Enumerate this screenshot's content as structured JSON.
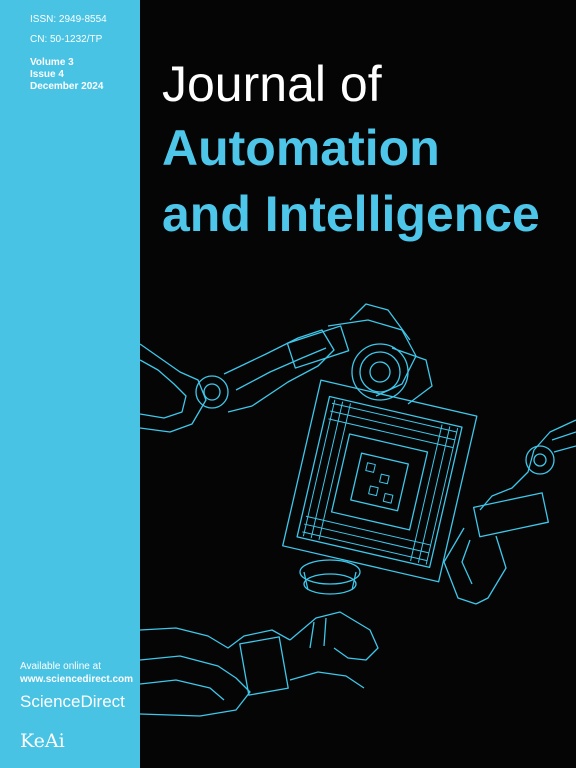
{
  "sidebar": {
    "issn": "ISSN: 2949-8554",
    "cn": "CN: 50-1232/TP",
    "volume": "Volume 3",
    "issue": "Issue 4",
    "date": "December 2024",
    "available": "Available online at",
    "url": "www.sciencedirect.com",
    "sciencedirect": "ScienceDirect",
    "publisher_logo": "KeAi"
  },
  "title": {
    "line1": "Journal of",
    "line2": "Automation",
    "line3": "and Intelligence"
  },
  "artwork": {
    "icon": "robot-arms-holding-chip-illustration",
    "line_color": "#3fc7ea",
    "background": "#050505"
  },
  "colors": {
    "sidebar": "#48c3e4",
    "accent": "#4ec6ea",
    "text_on_dark": "#ffffff"
  }
}
